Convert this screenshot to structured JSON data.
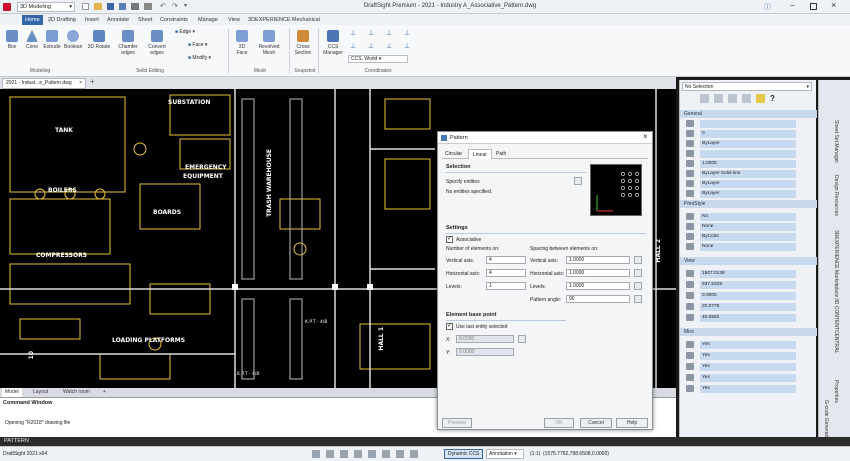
{
  "titlebar": {
    "workspace": "3D Modeling",
    "title": "DraftSight Premium - 2021 - Industry A_Associative_Pattern.dwg"
  },
  "ribbon": {
    "tabs": [
      "Home",
      "2D Drafting",
      "Insert",
      "Annotate",
      "Sheet",
      "Constraints",
      "Manage",
      "View",
      "3DEXPERIENCE",
      "Mechanical"
    ],
    "active_tab": "Home",
    "buttons": {
      "box": "Box",
      "cone": "Cone",
      "extrude": "Extrude",
      "boolean": "Boolean",
      "rotate3d": "3D Rotate",
      "chamfer": "Chamfer edges",
      "convert": "Convert edges",
      "edge": "Edge",
      "face": "Face",
      "modify": "Modify",
      "face3d": "3D Face",
      "revolved": "Revolved Mesh",
      "cross": "Cross Section",
      "ccs": "CCS Manager",
      "ccs_world": "CCS, World"
    },
    "groups": {
      "modeling": "Modeling",
      "solid": "Solid Editing",
      "mesh": "Mesh",
      "snapshot": "Snapshot",
      "coords": "Coordinates"
    }
  },
  "doc_tab": "2021 - Indust...e_Pattern.dwg",
  "canvas_labels": {
    "substation": "SUBSTATION",
    "tank": "TANK",
    "emergency": "EMERGENCY",
    "equipment": "EQUIPMENT",
    "boilers": "BOILERS",
    "boards": "BOARDS",
    "compressors": "COMPRESSORS",
    "loading": "LOADING PLATFORMS",
    "trash": "TRASH WAREHOUSE",
    "hall1": "HALL 1",
    "hall2": "HALL 2",
    "k1": "K.P.T - 4/8",
    "k2": "K.P.T - 4/8",
    "v10": "10"
  },
  "layout_tabs": [
    "Model",
    "Layout",
    "Watch room"
  ],
  "command_window": {
    "title": "Command Window",
    "line": "Opening \"R2018\" drawing file"
  },
  "command_input": "PATTERN",
  "status": {
    "app": "DraftSight 2021 x64",
    "dynamic_ccs": "Dynamic CCS",
    "annotation": "Annotation",
    "scale": "(1:1)",
    "coords": "(1575.7762,798.6508,0.0000)"
  },
  "properties": {
    "selection": "No Selection",
    "general": "General",
    "general_rows": [
      "0",
      "ByLayer",
      "1.0000",
      "ByLayer   Solid line",
      "ByLayer",
      "ByLayer",
      "None"
    ],
    "printstyle": "PrintStyle",
    "printstyle_rows": [
      "No",
      "None",
      "ByColor",
      "None"
    ],
    "view": "View",
    "view_rows": [
      "1507.0138",
      "937.5329",
      "0.0000",
      "20.0778",
      "40.5582"
    ],
    "misc": "Misc",
    "misc_rows": [
      "Yes",
      "Yes",
      "Yes",
      "Yes",
      "Yes"
    ]
  },
  "side_tabs": [
    "Properties",
    "Sheet Set Manager",
    "Design Resources",
    "3DEXPERIENCE Marketplace",
    "3D CONTENTCENTRAL",
    "G-code Generator"
  ],
  "dialog": {
    "title": "Pattern",
    "tabs": [
      "Circular",
      "Linear",
      "Path"
    ],
    "active_tab": "Linear",
    "selection_heading": "Selection",
    "specify_entities": "Specify entities",
    "no_entities": "No entities specified.",
    "settings_heading": "Settings",
    "associative": "Associative",
    "number_heading": "Number of elements on:",
    "spacing_heading": "Spacing between elements on:",
    "vertical_axis": "Vertical axis:",
    "horizontal_axis": "Horizontal axis:",
    "levels": "Levels:",
    "vertical_count": "4",
    "horizontal_count": "4",
    "levels_count": "1",
    "vertical_spacing": "1.0000",
    "horizontal_spacing": "1.0000",
    "levels_spacing": "1.0000",
    "pattern_angle_label": "Pattern angle:",
    "pattern_angle": "90",
    "base_heading": "Element base point",
    "use_last": "Use last entity selected",
    "x_label": "X:",
    "y_label": "Y:",
    "x_value": "0.0000",
    "y_value": "0.0000",
    "preview": "Preview",
    "ok": "OK",
    "cancel": "Cancel",
    "help": "Help"
  },
  "colors": {
    "accent": "#3467a8",
    "plan_lines": "#e8c23a",
    "plan_text": "#ffffff"
  }
}
